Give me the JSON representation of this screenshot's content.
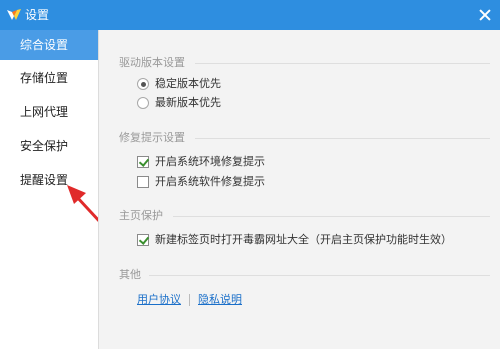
{
  "window": {
    "title": "设置"
  },
  "sidebar": {
    "items": [
      {
        "label": "综合设置",
        "active": true
      },
      {
        "label": "存储位置",
        "active": false
      },
      {
        "label": "上网代理",
        "active": false
      },
      {
        "label": "安全保护",
        "active": false
      },
      {
        "label": "提醒设置",
        "active": false
      }
    ]
  },
  "sections": {
    "driver": {
      "title": "驱动版本设置",
      "options": [
        {
          "label": "稳定版本优先",
          "selected": true
        },
        {
          "label": "最新版本优先",
          "selected": false
        }
      ]
    },
    "repair": {
      "title": "修复提示设置",
      "options": [
        {
          "label": "开启系统环境修复提示",
          "checked": true
        },
        {
          "label": "开启系统软件修复提示",
          "checked": false
        }
      ]
    },
    "homepage": {
      "title": "主页保护",
      "options": [
        {
          "label": "新建标签页时打开毒霸网址大全（开启主页保护功能时生效）",
          "checked": true
        }
      ]
    },
    "other": {
      "title": "其他",
      "links": [
        "用户协议",
        "隐私说明"
      ]
    }
  },
  "colors": {
    "titlebar": "#2e8ee0",
    "active_nav": "#4a9ce6",
    "content_bg": "#f3f3f3",
    "link": "#1a6fc9",
    "arrow": "#e02a2a",
    "check": "#3a8f2e"
  }
}
